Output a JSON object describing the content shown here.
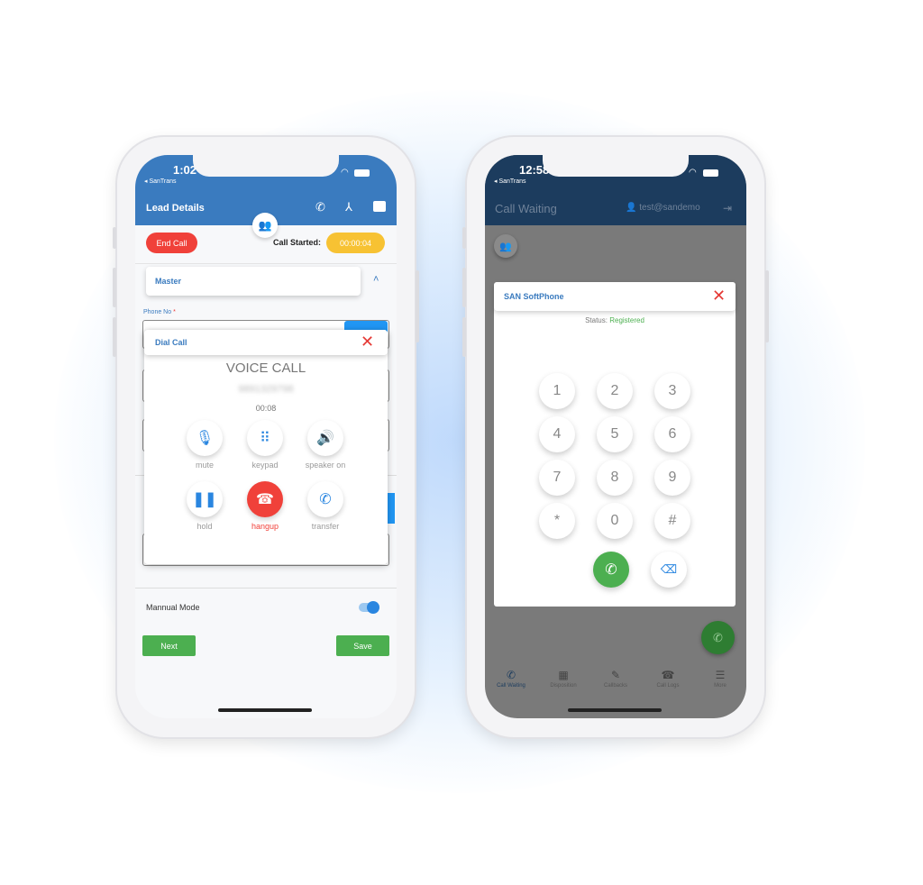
{
  "left_phone": {
    "status_time": "1:02",
    "carrier_back": "◂ SanTrans",
    "header": {
      "title": "Lead Details"
    },
    "end_call_label": "End Call",
    "call_started_label": "Call Started:",
    "call_timer": "00:00:04",
    "master_label": "Master",
    "phone_no_label": "Phone No",
    "required_mark": "*",
    "dial_call_title": "Dial Call",
    "voice_call": {
      "title": "VOICE CALL",
      "number": "9891329798",
      "duration": "00:08",
      "buttons": [
        {
          "label": "mute",
          "icon": "microphone-icon"
        },
        {
          "label": "keypad",
          "icon": "dialpad-icon"
        },
        {
          "label": "speaker on",
          "icon": "speaker-icon"
        },
        {
          "label": "hold",
          "icon": "pause-icon"
        },
        {
          "label": "hangup",
          "icon": "hangup-icon"
        },
        {
          "label": "transfer",
          "icon": "call-transfer-icon"
        }
      ]
    },
    "manual_mode_label": "Mannual Mode",
    "manual_mode_on": true,
    "next_label": "Next",
    "save_label": "Save"
  },
  "right_phone": {
    "status_time": "12:58",
    "carrier_back": "◂ SanTrans",
    "header": {
      "title": "Call Waiting",
      "user": "test@sandemo"
    },
    "softphone": {
      "title": "SAN SoftPhone",
      "status_label": "Status:",
      "status_value": "Registered",
      "keys": [
        "1",
        "2",
        "3",
        "4",
        "5",
        "6",
        "7",
        "8",
        "9",
        "*",
        "0",
        "#"
      ]
    },
    "nav": [
      "Call Waiting",
      "Disposition",
      "Callbacks",
      "Call Logs",
      "More"
    ]
  },
  "colors": {
    "blue_header": "#3a7bbf",
    "dark_header": "#1c3c5e",
    "red": "#f0413a",
    "yellow": "#f7c233",
    "green": "#4caf50",
    "accent": "#2a86e0"
  }
}
